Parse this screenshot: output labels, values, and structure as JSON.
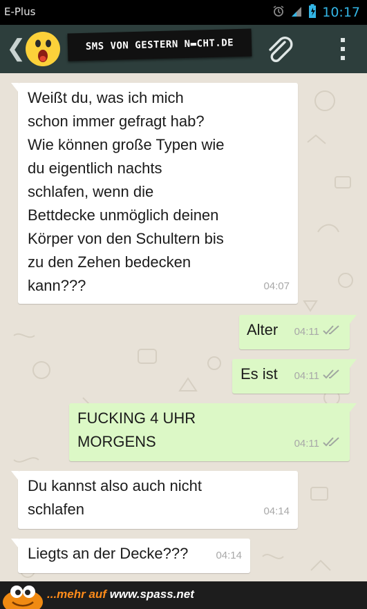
{
  "status_bar": {
    "carrier": "E-Plus",
    "time": "10:17",
    "icons": [
      "alarm-icon",
      "signal-icon",
      "battery-icon"
    ]
  },
  "app_bar": {
    "back_icon": "chevron-left-icon",
    "avatar_icon": "surprised-face-icon",
    "banner_text": "SMS VON GESTERN N▬CHT.DE",
    "attach_icon": "paperclip-icon",
    "menu_icon": "overflow-menu-icon"
  },
  "messages": [
    {
      "direction": "incoming",
      "text": "Weißt du, was ich mich\nschon immer gefragt hab?\nWie können große Typen wie\ndu eigentlich nachts\nschlafen, wenn die\nBettdecke unmöglich deinen\nKörper von den Schultern bis\nzu den Zehen bedecken\nkann???",
      "time": "04:07"
    },
    {
      "direction": "outgoing",
      "text": "Alter",
      "time": "04:11",
      "status": "read"
    },
    {
      "direction": "outgoing",
      "text": "Es ist",
      "time": "04:11",
      "status": "read"
    },
    {
      "direction": "outgoing",
      "text": "FUCKING 4 UHR\nMORGENS",
      "time": "04:11",
      "status": "read"
    },
    {
      "direction": "incoming",
      "text": "Du kannst also auch nicht\nschlafen",
      "time": "04:14"
    },
    {
      "direction": "incoming",
      "text": "Liegts an der Decke???",
      "time": "04:14"
    }
  ],
  "footer": {
    "prefix": "...mehr auf ",
    "site": "www.spass.net"
  },
  "colors": {
    "app_bar": "#2d3e3c",
    "outgoing_bubble": "#dcf8c6",
    "incoming_bubble": "#ffffff",
    "chat_background": "#e8e2d8",
    "status_clock": "#33b5e5",
    "footer_accent": "#ff8c1a"
  }
}
